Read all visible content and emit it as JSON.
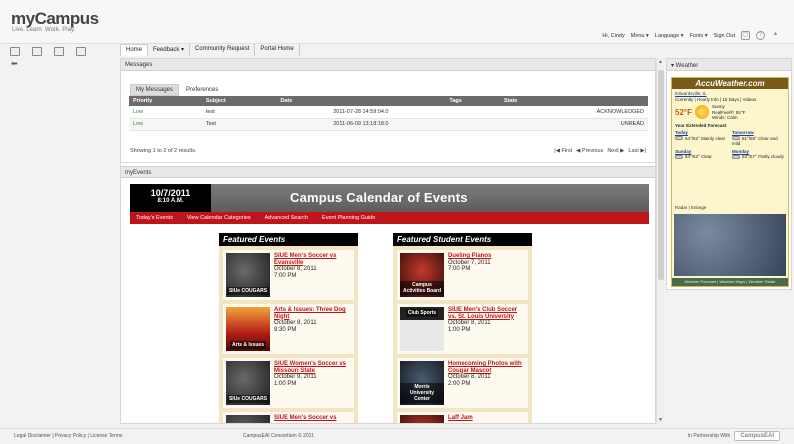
{
  "brand": {
    "name": "myCampus",
    "tagline": "Live. Learn. Work. Play."
  },
  "user_menu": {
    "greeting": "Hi, Cindy",
    "menu": "Menu ▾",
    "language": "Language ▾",
    "fonts": "Fonts ▾",
    "signout": "Sign Out"
  },
  "nav": {
    "tabs": [
      "Home",
      "Feedback ▾",
      "Community Request",
      "Portal Home"
    ]
  },
  "messages": {
    "title": "Messages",
    "tabs": [
      "My Messages",
      "Preferences"
    ],
    "columns": [
      "Priority",
      "Subject",
      "Date",
      "Tags",
      "State"
    ],
    "rows": [
      {
        "priority": "Low",
        "subject": "test",
        "date": "2011-07-28 14:59:04.0",
        "tags": "",
        "state": "ACKNOWLEDGED"
      },
      {
        "priority": "Low",
        "subject": "Test",
        "date": "2011-06-09 13:18:18.0",
        "tags": "",
        "state": "UNREAD"
      }
    ],
    "showing": "Showing 1 to 2 of 2 results.",
    "pager": [
      "|◀ First",
      "◀ Previous",
      "Next ▶",
      "Last ▶|"
    ]
  },
  "myevents": {
    "title": "myEvents",
    "date": "10/7/2011",
    "time": "8:10 A.M.",
    "calendar_title": "Campus Calendar of Events",
    "menu": [
      "Today's Events",
      "View Calendar Categories",
      "Advanced Search",
      "Event Planning Guide"
    ],
    "featured": {
      "heading": "Featured Events",
      "items": [
        {
          "title": "SIUE Men's Soccer vs Evansville",
          "date": "October 8, 2011",
          "time": "7:00 PM",
          "image_label": "SIUe COUGARS"
        },
        {
          "title": "Arts & Issues: Three Dog Night",
          "date": "October 8, 2011",
          "time": "9:30 PM",
          "image_label": "Arts & Issues"
        },
        {
          "title": "SIUE Women's Soccer vs Missouri State",
          "date": "October 9, 2011",
          "time": "1:00 PM",
          "image_label": "SIUe COUGARS"
        },
        {
          "title": "SIUE Men's Soccer vs",
          "date": "",
          "time": "",
          "image_label": ""
        }
      ]
    },
    "student": {
      "heading": "Featured Student Events",
      "items": [
        {
          "title": "Dueling Pianos",
          "date": "October 7, 2011",
          "time": "7:00 PM",
          "image_label": "Campus Activities Board"
        },
        {
          "title": "SIUE Men's Club Soccer vs. St. Louis University",
          "date": "October 8, 2011",
          "time": "1:00 PM",
          "image_label": "Club Sports"
        },
        {
          "title": "Homecoming Photos with Cougar Mascot",
          "date": "October 8, 2011",
          "time": "2:00 PM",
          "image_label": "Morris University Center"
        },
        {
          "title": "Laff Jam",
          "date": "",
          "time": "",
          "image_label": ""
        }
      ]
    }
  },
  "weather": {
    "title": "▾ Weather",
    "brand": "AccuWeather.com",
    "location": "Edwardsville, IL",
    "links": "Currently | Hourly Info | 15 Days | Videos",
    "temp": "52°F",
    "conditions": "Sunny",
    "realfeel": "RealFeel®: 55°F",
    "winds": "Winds: Calm",
    "forecast_heading": "Your Extended Forecast",
    "forecast": [
      {
        "day": "Today",
        "hilo": "84°/62°",
        "desc": "Mainly clear"
      },
      {
        "day": "Tomorrow",
        "hilo": "81°/58°",
        "desc": "Clear and mild"
      },
      {
        "day": "Sunday",
        "hilo": "83°/52°",
        "desc": "Clear"
      },
      {
        "day": "Monday",
        "hilo": "83°/57°",
        "desc": "Partly cloudy"
      }
    ],
    "radar": "Radar | Enlarge",
    "footer": "Weather Forecast | Weather Maps | Weather Radar"
  },
  "footer": {
    "left": "Legal Disclaimer | Privacy Policy | License Terms",
    "mid": "CampusEAI Consortium © 2011",
    "right": "In Partnership With",
    "logo": "CampusEAI"
  }
}
